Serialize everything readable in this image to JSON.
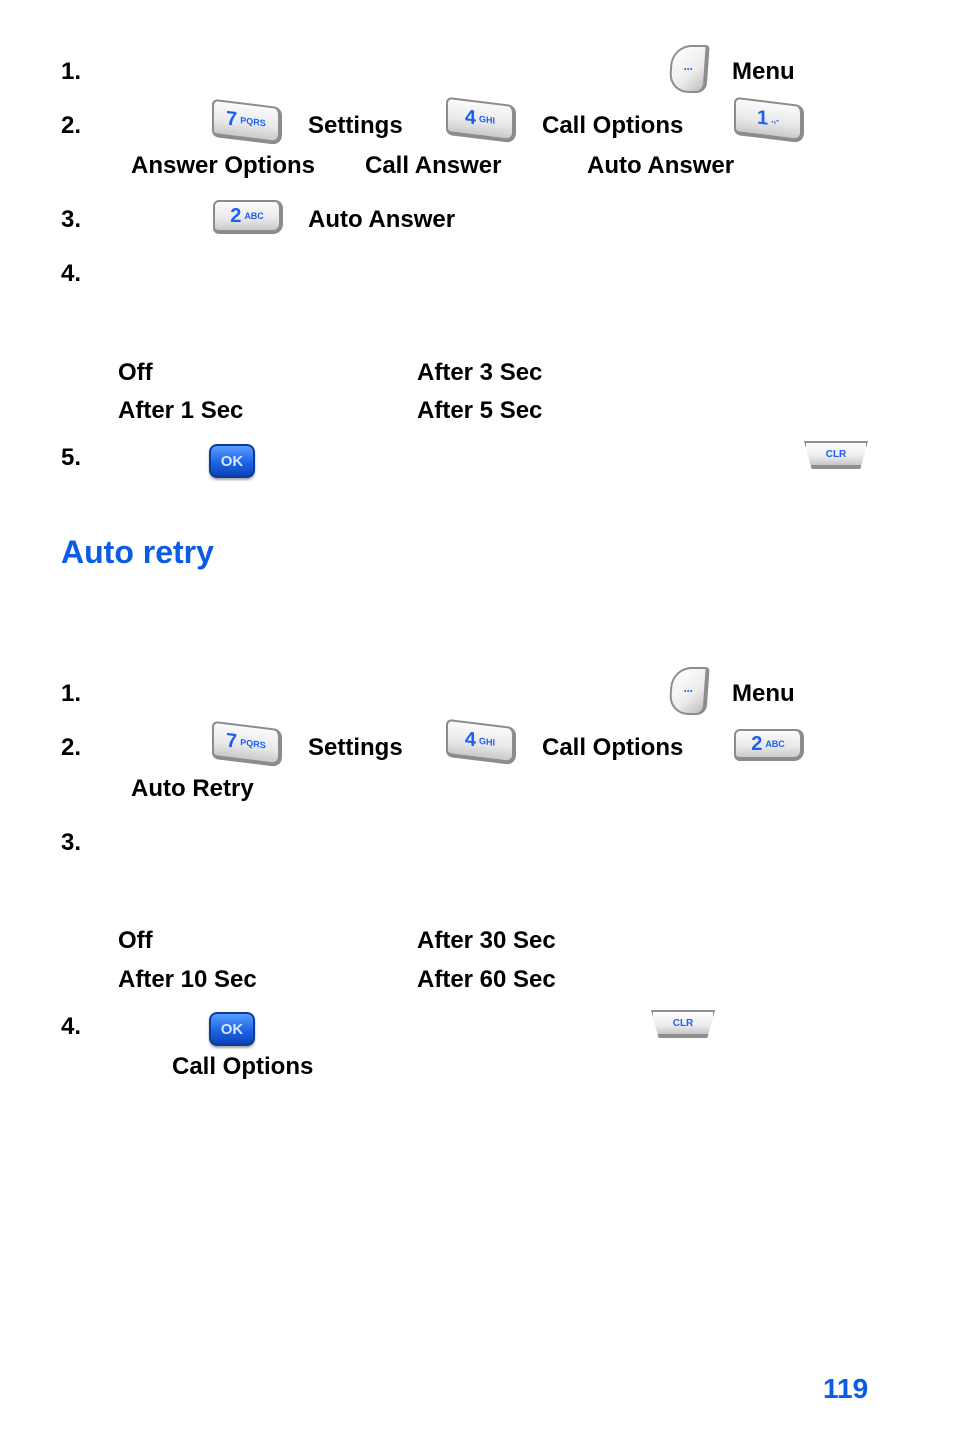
{
  "section1": {
    "steps": [
      {
        "number": "1.",
        "items": [
          {
            "icon": "menu-softkey-icon"
          },
          {
            "text": "Menu"
          }
        ]
      },
      {
        "number": "2.",
        "items": [
          {
            "key": {
              "digit": "7",
              "letters": "PQRS"
            }
          },
          {
            "text": "Settings"
          },
          {
            "key": {
              "digit": "4",
              "letters": "GHI"
            }
          },
          {
            "text": "Call Options"
          },
          {
            "key": {
              "digit": "1",
              "letters": ".,-"
            }
          }
        ],
        "line2": [
          "Answer Options",
          "Call Answer",
          "Auto Answer"
        ]
      },
      {
        "number": "3.",
        "items": [
          {
            "key": {
              "digit": "2",
              "letters": "ABC"
            }
          },
          {
            "text": "Auto Answer"
          }
        ]
      },
      {
        "number": "4.",
        "options": [
          [
            "Off",
            "After 3 Sec"
          ],
          [
            "After 1 Sec",
            "After 5 Sec"
          ]
        ]
      },
      {
        "number": "5.",
        "items": [
          {
            "icon": "ok-key-icon",
            "label": "OK"
          },
          {
            "icon": "clr-key-icon",
            "label": "CLR"
          }
        ]
      }
    ]
  },
  "section2": {
    "heading": "Auto retry",
    "steps": [
      {
        "number": "1.",
        "items": [
          {
            "icon": "menu-softkey-icon"
          },
          {
            "text": "Menu"
          }
        ]
      },
      {
        "number": "2.",
        "items": [
          {
            "key": {
              "digit": "7",
              "letters": "PQRS"
            }
          },
          {
            "text": "Settings"
          },
          {
            "key": {
              "digit": "4",
              "letters": "GHI"
            }
          },
          {
            "text": "Call Options"
          },
          {
            "key": {
              "digit": "2",
              "letters": "ABC"
            }
          }
        ],
        "line2": [
          "Auto Retry"
        ]
      },
      {
        "number": "3.",
        "options": [
          [
            "Off",
            "After 30 Sec"
          ],
          [
            "After 10 Sec",
            "After 60 Sec"
          ]
        ]
      },
      {
        "number": "4.",
        "items": [
          {
            "icon": "ok-key-icon",
            "label": "OK"
          },
          {
            "icon": "clr-key-icon",
            "label": "CLR"
          }
        ],
        "line2": [
          "Call Options"
        ]
      }
    ]
  },
  "page_number": "119",
  "colors": {
    "accent": "#0a5ce6",
    "key_text": "#1d5ff2"
  }
}
